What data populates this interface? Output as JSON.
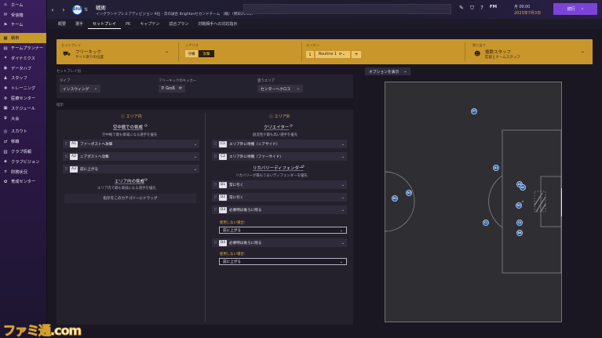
{
  "nav": {
    "items": [
      {
        "label": "ホーム",
        "icon": "home-icon",
        "glyph": "⌂"
      },
      {
        "label": "受信箱",
        "icon": "inbox-icon",
        "glyph": "✉"
      },
      {
        "label": "チーム",
        "icon": "team-icon",
        "glyph": "⚑"
      },
      {
        "label": "戦術",
        "icon": "tactics-icon",
        "glyph": "▦",
        "active": true
      },
      {
        "label": "チームプランナー",
        "icon": "planner-icon",
        "glyph": "▤"
      },
      {
        "label": "ダイナミクス",
        "icon": "dynamics-icon",
        "glyph": "✦"
      },
      {
        "label": "データハブ",
        "icon": "data-hub-icon",
        "glyph": "◉"
      },
      {
        "label": "スタッフ",
        "icon": "staff-icon",
        "glyph": "♟"
      },
      {
        "label": "トレーニング",
        "icon": "training-icon",
        "glyph": "✚"
      },
      {
        "label": "医療センター",
        "icon": "medical-icon",
        "glyph": "✙"
      },
      {
        "label": "スケジュール",
        "icon": "schedule-icon",
        "glyph": "▣"
      },
      {
        "label": "大会",
        "icon": "competition-icon",
        "glyph": "♛"
      },
      {
        "label": "スカウト",
        "icon": "scout-icon",
        "glyph": "◎"
      },
      {
        "label": "移籍",
        "icon": "transfer-icon",
        "glyph": "⇄"
      },
      {
        "label": "クラブ情報",
        "icon": "club-info-icon",
        "glyph": "▥"
      },
      {
        "label": "クラブビジョン",
        "icon": "club-vision-icon",
        "glyph": "◈"
      },
      {
        "label": "財務状況",
        "icon": "finance-icon",
        "glyph": "¤"
      },
      {
        "label": "育成センター",
        "icon": "development-icon",
        "glyph": "✿"
      }
    ]
  },
  "header": {
    "club_badge": "BHA",
    "title": "戦術",
    "subtitle": "イングランドプレミアディビジョン 9位 - 次の試合 Brightonセカンドチーム （敵）（明日20:00）",
    "time": "月 09:00",
    "date": "2023年7月3日",
    "continue_label": "続行"
  },
  "tabs": [
    "概要",
    "選手",
    "セットプレイ",
    "PK",
    "キャプテン",
    "試合プラン",
    "対戦相手への対応指示"
  ],
  "active_tab": 2,
  "setpiece": {
    "type_label": "セットプレイ",
    "type_value": "フリーキック",
    "type_sub": "サイド寄りの位置",
    "scenario_label": "シナリオ",
    "defend_label": "守備",
    "attack_label": "攻撃",
    "routine_label": "ルーチン",
    "routine_num": "1",
    "routine_value": "Routine 1",
    "routine_plus": "+",
    "assign_label": "割り当て",
    "assign_value": "複数スタッフ",
    "assign_sub": "監督とチームスタッフ"
  },
  "setup": {
    "section": "セットプレイ別",
    "options_label": "オプションを表示",
    "type_label": "タイプ",
    "type_value": "インスウィング",
    "taker_label": "フリーキックのキッカー",
    "taker_value": "P. Groß",
    "zone_label": "狙うエリア",
    "zone_value": "センターへクロス"
  },
  "main": {
    "section": "指示",
    "left_head": "エリア内",
    "right_head": "エリア外",
    "left": {
      "g1_title": "空中戦での脅威",
      "g1_sub": "空中戦で最も脅威になる選手を優先",
      "g1_rows": [
        {
          "pill": "A1",
          "text": "ファーポストへ攻撃"
        },
        {
          "pill": "A2",
          "text": "ニアポストへ攻撃"
        },
        {
          "pill": "A3",
          "text": "前に上がる"
        }
      ],
      "g2_title": "エリア内の脅威",
      "g2_sub": "エリア内で最も脅威になる選手を優先",
      "drag_text": "指示をこのカテゴリーにドラッグ"
    },
    "right": {
      "g1_title": "クリエイター",
      "g1_sub": "創造性が最も高い選手を優先",
      "g1_rows": [
        {
          "pill": "C1",
          "text": "エリア外に待機（ニアサイド）"
        },
        {
          "pill": "C2",
          "text": "エリア外に待機（ファーサイド）"
        }
      ],
      "g2_title": "リカバリーディフェンダー",
      "g2_sub": "リカバリーが最もうまいディフェンダーを優先",
      "g2_rows": [
        {
          "pill": "D1",
          "text": "常に引く"
        },
        {
          "pill": "D2",
          "text": "常に引く"
        },
        {
          "pill": "D3",
          "text": "必要時は後ろに残る"
        }
      ],
      "fallback1_label": "使用しない場合：",
      "fallback1_value": "前に上がる",
      "d4": {
        "pill": "D4",
        "text": "必要時は後ろに残る"
      },
      "fallback2_label": "使用しない場合：",
      "fallback2_value": "前に上がる"
    }
  },
  "pitch": {
    "players": [
      {
        "label": "FT"
      },
      {
        "label": "A1"
      },
      {
        "label": "A3"
      },
      {
        "label": "A2"
      },
      {
        "label": "D1"
      },
      {
        "label": "D2"
      },
      {
        "label": "D3"
      },
      {
        "label": "C1"
      },
      {
        "label": "C2"
      },
      {
        "label": "D4"
      }
    ]
  },
  "watermark": "ファミ通.com"
}
